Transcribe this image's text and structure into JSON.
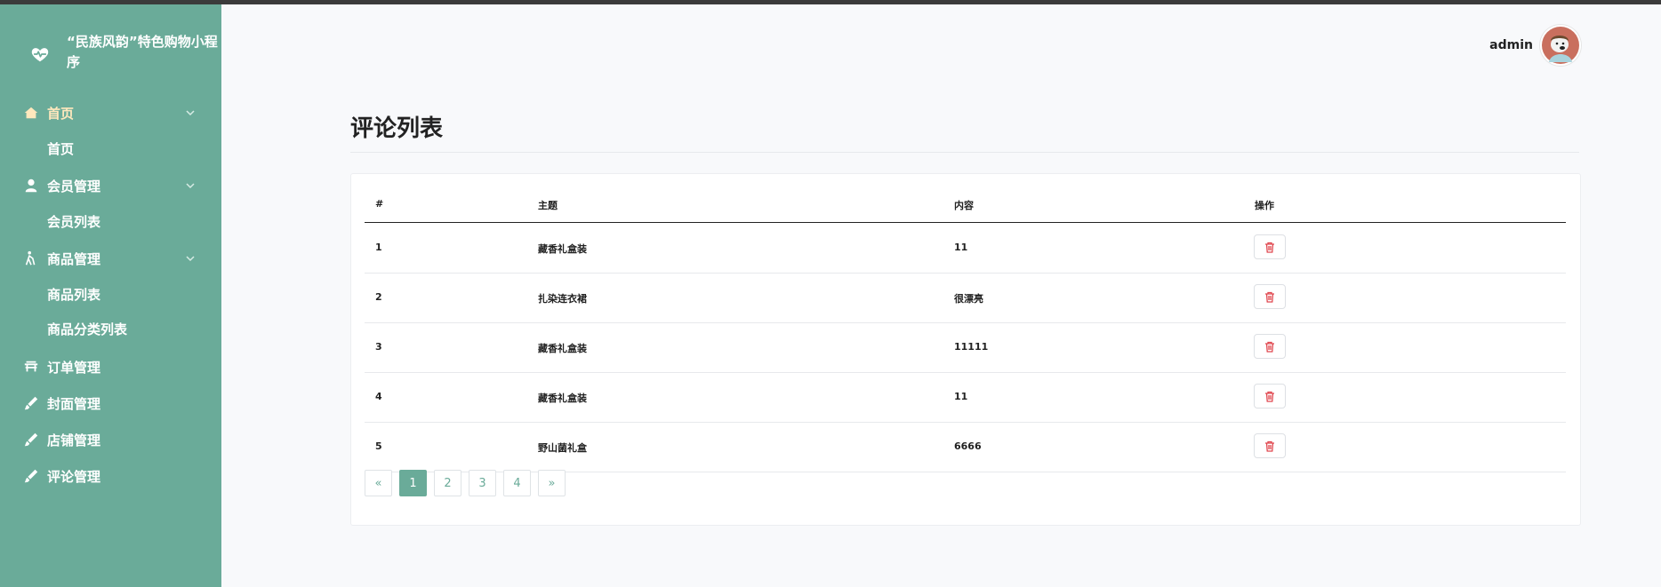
{
  "app": {
    "title": "“民族风韵”特色购物小程序",
    "colors": {
      "sidebar": "#6aab99",
      "active_label": "#ffe8bd",
      "danger": "#e0474f"
    }
  },
  "sidebar": {
    "groups": [
      {
        "label": "首页",
        "icon": "house-icon",
        "expanded": true,
        "children": [
          "首页"
        ]
      },
      {
        "label": "会员管理",
        "icon": "user-icon",
        "expanded": true,
        "children": [
          "会员列表"
        ]
      },
      {
        "label": "商品管理",
        "icon": "walker-icon",
        "expanded": true,
        "children": [
          "商品列表",
          "商品分类列表"
        ]
      },
      {
        "label": "订单管理",
        "icon": "bench-icon",
        "children": []
      },
      {
        "label": "封面管理",
        "icon": "brush-icon",
        "children": []
      },
      {
        "label": "店铺管理",
        "icon": "brush-icon",
        "children": []
      },
      {
        "label": "评论管理",
        "icon": "brush-icon",
        "children": []
      }
    ]
  },
  "header": {
    "username": "admin",
    "avatar": "bear-avatar"
  },
  "page": {
    "title": "评论列表"
  },
  "table": {
    "columns": [
      "#",
      "主题",
      "内容",
      "操作"
    ],
    "rows": [
      {
        "id": "1",
        "subject": "藏香礼盒装",
        "content": "11"
      },
      {
        "id": "2",
        "subject": "扎染连衣裙",
        "content": "很漂亮"
      },
      {
        "id": "3",
        "subject": "藏香礼盒装",
        "content": "11111"
      },
      {
        "id": "4",
        "subject": "藏香礼盒装",
        "content": "11"
      },
      {
        "id": "5",
        "subject": "野山菌礼盒",
        "content": "6666"
      }
    ],
    "action_icon": "trash-icon"
  },
  "pagination": {
    "prev": "«",
    "pages": [
      "1",
      "2",
      "3",
      "4"
    ],
    "current": "1",
    "next": "»"
  }
}
